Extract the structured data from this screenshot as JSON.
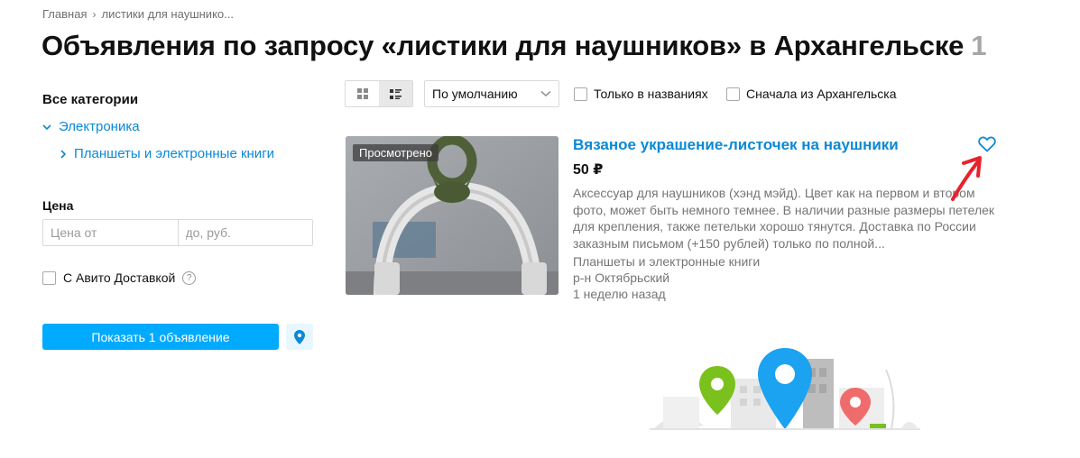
{
  "breadcrumb": {
    "home": "Главная",
    "separator": "›",
    "current": "листики для наушнико..."
  },
  "page": {
    "title": "Объявления по запросу «листики для наушников» в Архангельске",
    "result_count": "1"
  },
  "sidebar": {
    "categories_heading": "Все категории",
    "categories": [
      {
        "label": "Электроника",
        "icon": "chevron-down-icon"
      },
      {
        "label": "Планшеты и электронные книги",
        "icon": "chevron-right-icon"
      }
    ],
    "price": {
      "label": "Цена",
      "from_placeholder": "Цена от",
      "to_placeholder": "до, руб.",
      "from_value": "",
      "to_value": ""
    },
    "delivery_label": "С Авито Доставкой",
    "delivery_checked": false,
    "show_button": "Показать 1 объявление"
  },
  "toolbar": {
    "views": [
      {
        "icon": "grid-view-icon",
        "active": false
      },
      {
        "icon": "list-view-icon",
        "active": true
      }
    ],
    "sort_selected": "По умолчанию",
    "filters": [
      {
        "label": "Только в названиях",
        "checked": false
      },
      {
        "label": "Сначала из Архангельска",
        "checked": false
      }
    ]
  },
  "listing": {
    "badge": "Просмотрено",
    "title": "Вязаное украшение-листочек на наушники",
    "price": "50 ₽",
    "description": "Аксессуар для наушников (хэнд мэйд). Цвет как на первом и втором фото, может быть немного темнее. В наличии разные размеры петелек для крепления, также петельки хорошо тянутся. Доставка по России заказным письмом (+150 рублей) только по полной...",
    "category": "Планшеты и электронные книги",
    "district": "р-н Октябрьский",
    "posted": "1 неделю назад",
    "favorite_icon": "heart-outline-icon"
  },
  "colors": {
    "accent": "#00aaff",
    "link": "#0a89d6",
    "annotation": "#e8222b"
  }
}
